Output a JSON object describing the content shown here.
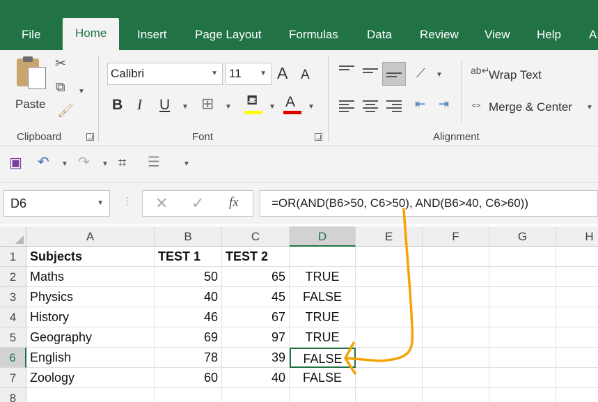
{
  "tabs": [
    {
      "label": "File",
      "active": false
    },
    {
      "label": "Home",
      "active": true
    },
    {
      "label": "Insert",
      "active": false
    },
    {
      "label": "Page Layout",
      "active": false
    },
    {
      "label": "Formulas",
      "active": false
    },
    {
      "label": "Data",
      "active": false
    },
    {
      "label": "Review",
      "active": false
    },
    {
      "label": "View",
      "active": false
    },
    {
      "label": "Help",
      "active": false
    },
    {
      "label": "A",
      "active": false
    }
  ],
  "ribbon": {
    "clipboard": {
      "label": "Clipboard",
      "paste_label": "Paste"
    },
    "font": {
      "label": "Font",
      "font_name": "Calibri",
      "font_size": "11",
      "bold": "B",
      "italic": "I",
      "underline": "U",
      "grow": "A",
      "shrink": "A",
      "font_color": "A"
    },
    "alignment": {
      "label": "Alignment",
      "wrap_text": "Wrap Text",
      "merge_center": "Merge & Center"
    }
  },
  "formula_bar": {
    "name_box": "D6",
    "fx": "fx",
    "formula": "=OR(AND(B6>50, C6>50), AND(B6>40, C6>60))"
  },
  "grid": {
    "columns": [
      "A",
      "B",
      "C",
      "D",
      "E",
      "F",
      "G",
      "H"
    ],
    "selected_column": "D",
    "selected_row": "6",
    "rows": [
      {
        "num": "1",
        "A": "Subjects",
        "B": "TEST 1",
        "C": "TEST 2",
        "D": ""
      },
      {
        "num": "2",
        "A": "Maths",
        "B": "50",
        "C": "65",
        "D": "TRUE"
      },
      {
        "num": "3",
        "A": "Physics",
        "B": "40",
        "C": "45",
        "D": "FALSE"
      },
      {
        "num": "4",
        "A": "History",
        "B": "46",
        "C": "67",
        "D": "TRUE"
      },
      {
        "num": "5",
        "A": "Geography",
        "B": "69",
        "C": "97",
        "D": "TRUE"
      },
      {
        "num": "6",
        "A": "English",
        "B": "78",
        "C": "39",
        "D": "FALSE"
      },
      {
        "num": "7",
        "A": "Zoology",
        "B": "60",
        "C": "40",
        "D": "FALSE"
      },
      {
        "num": "8",
        "A": "",
        "B": "",
        "C": "",
        "D": ""
      }
    ]
  },
  "colors": {
    "accent": "#217346",
    "annotation": "#f5a300",
    "highlight": "#ffff00",
    "font_color": "#e00000"
  }
}
